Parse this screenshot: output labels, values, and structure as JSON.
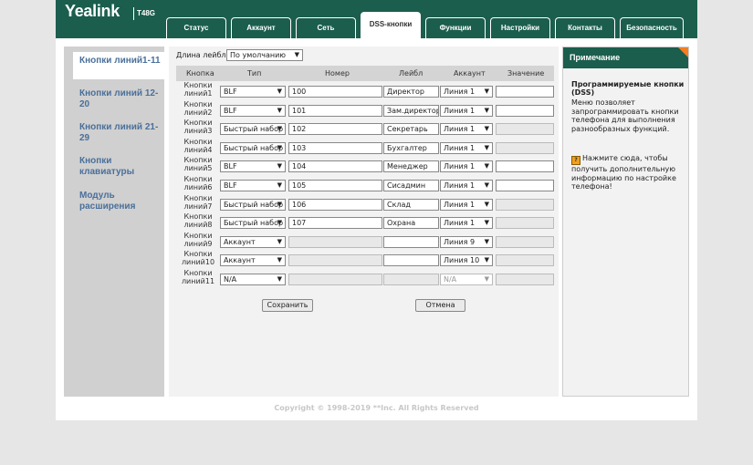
{
  "header": {
    "logo": "Yealink",
    "model": "T48G",
    "tabs": [
      {
        "label": "Статус"
      },
      {
        "label": "Аккаунт"
      },
      {
        "label": "Сеть"
      },
      {
        "label": "DSS-кнопки",
        "active": true
      },
      {
        "label": "Функции"
      },
      {
        "label": "Настройки"
      },
      {
        "label": "Контакты"
      },
      {
        "label": "Безопасность"
      }
    ]
  },
  "sidebar": {
    "items": [
      {
        "label": "Кнопки линий1-11",
        "active": true
      },
      {
        "label": "Кнопки линий 12-20"
      },
      {
        "label": "Кнопки линий 21-29"
      },
      {
        "label": "Кнопки клавиатуры"
      },
      {
        "label": "Модуль расширения"
      }
    ]
  },
  "main": {
    "label_length_label": "Длина лейбла",
    "label_length_value": "По умолчанию",
    "columns": [
      "Кнопка",
      "Тип",
      "Номер",
      "Лейбл",
      "Аккаунт",
      "Значение"
    ],
    "rows": [
      {
        "key": "Кнопки линий1",
        "type": "BLF",
        "number": "100",
        "label": "Директор",
        "account": "Линия 1",
        "value": "",
        "value_disabled": false
      },
      {
        "key": "Кнопки линий2",
        "type": "BLF",
        "number": "101",
        "label": "Зам.директора",
        "account": "Линия 1",
        "value": "",
        "value_disabled": false
      },
      {
        "key": "Кнопки линий3",
        "type": "Быстрый набор",
        "number": "102",
        "label": "Секретарь",
        "account": "Линия 1",
        "value": "",
        "value_disabled": true
      },
      {
        "key": "Кнопки линий4",
        "type": "Быстрый набор",
        "number": "103",
        "label": "Бухгалтер",
        "account": "Линия 1",
        "value": "",
        "value_disabled": true
      },
      {
        "key": "Кнопки линий5",
        "type": "BLF",
        "number": "104",
        "label": "Менеджер",
        "account": "Линия 1",
        "value": "",
        "value_disabled": false
      },
      {
        "key": "Кнопки линий6",
        "type": "BLF",
        "number": "105",
        "label": "Сисадмин",
        "account": "Линия 1",
        "value": "",
        "value_disabled": false
      },
      {
        "key": "Кнопки линий7",
        "type": "Быстрый набор",
        "number": "106",
        "label": "Склад",
        "account": "Линия 1",
        "value": "",
        "value_disabled": true
      },
      {
        "key": "Кнопки линий8",
        "type": "Быстрый набор",
        "number": "107",
        "label": "Охрана",
        "account": "Линия 1",
        "value": "",
        "value_disabled": true
      },
      {
        "key": "Кнопки линий9",
        "type": "Аккаунт",
        "number": "",
        "number_disabled": true,
        "label": "",
        "account": "Линия 9",
        "value": "",
        "value_disabled": true
      },
      {
        "key": "Кнопки линий10",
        "type": "Аккаунт",
        "number": "",
        "number_disabled": true,
        "label": "",
        "account": "Линия 10",
        "value": "",
        "value_disabled": true
      },
      {
        "key": "Кнопки линий11",
        "type": "N/A",
        "number": "",
        "number_disabled": true,
        "label": "",
        "label_disabled": true,
        "account": "N/A",
        "account_disabled": true,
        "value": "",
        "value_disabled": true
      }
    ],
    "save_label": "Сохранить",
    "cancel_label": "Отмена"
  },
  "note": {
    "header": "Примечание",
    "title": "Программируемые кнопки (DSS)",
    "text": "Меню позволяет запрограммировать кнопки телефона для выполнения разнообразных функций.",
    "link": "Нажмите сюда, чтобы получить дополнительную информацию по настройке телефона!"
  },
  "footer": {
    "copyright": "Copyright © 1998-2019 **Inc. All Rights Reserved"
  },
  "colors": {
    "brand": "#1b5e4d",
    "sidebar_link": "#4a6f9a",
    "note_corner": "#f47e20"
  }
}
